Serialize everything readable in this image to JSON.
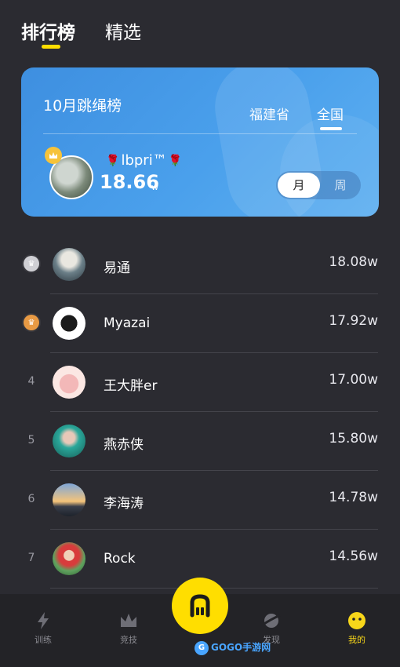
{
  "top_tabs": [
    {
      "label": "排行榜",
      "active": true
    },
    {
      "label": "精选",
      "active": false
    }
  ],
  "hero": {
    "title": "10月跳绳榜",
    "region_tabs": [
      {
        "label": "福建省",
        "active": false
      },
      {
        "label": "全国",
        "active": true
      }
    ],
    "leader": {
      "name_prefix": "🌹",
      "name": "lbpri™",
      "name_suffix": "🌹",
      "score": "18.66",
      "unit": "w"
    },
    "period_tabs": [
      {
        "label": "月",
        "active": true
      },
      {
        "label": "周",
        "active": false
      }
    ]
  },
  "ranking": [
    {
      "rank": "",
      "medal": "silver",
      "name": "易通",
      "score": "18.08w"
    },
    {
      "rank": "",
      "medal": "bronze",
      "name": "Myazai",
      "score": "17.92w"
    },
    {
      "rank": "4",
      "medal": "",
      "name": "王大胖er",
      "score": "17.00w"
    },
    {
      "rank": "5",
      "medal": "",
      "name": "燕赤侠",
      "score": "15.80w"
    },
    {
      "rank": "6",
      "medal": "",
      "name": "李海涛",
      "score": "14.78w"
    },
    {
      "rank": "7",
      "medal": "",
      "name": "Rock",
      "score": "14.56w"
    }
  ],
  "tabbar": {
    "items": [
      {
        "label": "训练",
        "icon": "lightning-icon",
        "active": false
      },
      {
        "label": "竞技",
        "icon": "crown-icon",
        "active": false
      },
      {
        "label": "发现",
        "icon": "planet-icon",
        "active": false
      },
      {
        "label": "我的",
        "icon": "smile-icon",
        "active": true
      }
    ],
    "center_icon": "rope-icon"
  },
  "watermark": {
    "text": "GOGO手游网"
  },
  "colors": {
    "accent": "#ffde00",
    "background": "#2b2b31",
    "hero": "#4a9ce8"
  }
}
